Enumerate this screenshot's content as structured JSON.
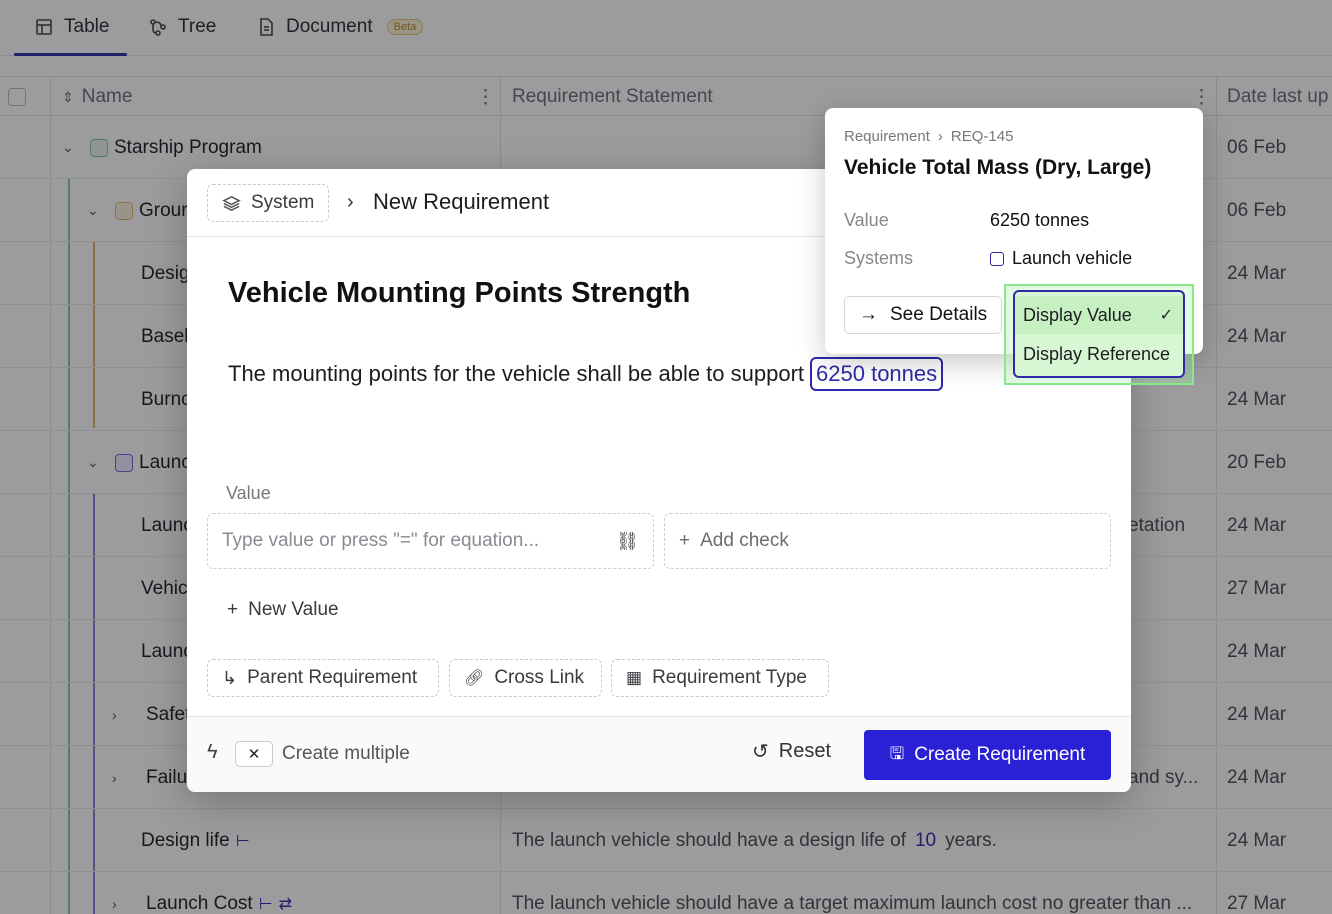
{
  "tabs": [
    {
      "label": "Table",
      "icon": "table-icon",
      "active": true
    },
    {
      "label": "Tree",
      "icon": "tree-icon",
      "active": false
    },
    {
      "label": "Document",
      "icon": "document-icon",
      "active": false,
      "badge": "Beta"
    }
  ],
  "grid": {
    "columns": {
      "name": "Name",
      "statement": "Requirement Statement",
      "date": "Date last up"
    },
    "rows": [
      {
        "name": "Starship Program",
        "date": "06 Feb"
      },
      {
        "name": "Grour",
        "date": "06 Feb"
      },
      {
        "name": "Desig",
        "date": "24 Mar"
      },
      {
        "name": "Basel",
        "date": "24 Mar"
      },
      {
        "name": "Burnc",
        "date": "24 Mar"
      },
      {
        "name": "Launc",
        "date": "20 Feb"
      },
      {
        "name": "Launc",
        "date": "24 Mar",
        "statement_tail": "etation"
      },
      {
        "name": "Vehic",
        "date": "27 Mar"
      },
      {
        "name": "Launc",
        "date": "24 Mar"
      },
      {
        "name": "Safet",
        "date": "24 Mar"
      },
      {
        "name": "Failur",
        "date": "24 Mar",
        "statement_tail": "and sy..."
      },
      {
        "name": "Design life",
        "date": "24 Mar",
        "statement_pre": "The launch vehicle should have a design life of",
        "statement_value": "10",
        "statement_post": "years."
      },
      {
        "name": "Launch Cost",
        "date": "27 Mar",
        "statement": "The launch vehicle should have a target maximum launch cost no greater than ..."
      }
    ]
  },
  "modal": {
    "system_label": "System",
    "title": "New Requirement",
    "requirement_title": "Vehicle Mounting Points Strength",
    "statement_text": "The mounting points for the vehicle shall be able to support",
    "statement_ref": "6250 tonnes",
    "value_label": "Value",
    "value_placeholder": "Type value or press \"=\" for equation...",
    "add_check": "Add check",
    "new_value": "New Value",
    "chips": [
      "Parent Requirement",
      "Cross Link",
      "Requirement Type"
    ],
    "create_multiple": "Create multiple",
    "kbd": "✕",
    "reset": "Reset",
    "create": "Create Requirement"
  },
  "card": {
    "crumb_root": "Requirement",
    "crumb_id": "REQ-145",
    "title": "Vehicle Total Mass (Dry, Large)",
    "value_key": "Value",
    "value": "6250 tonnes",
    "systems_key": "Systems",
    "system": "Launch vehicle",
    "see_details": "See Details"
  },
  "menu": {
    "items": [
      "Display Value",
      "Display Reference"
    ],
    "selected": "Display Value"
  },
  "colors": {
    "accent": "#2a20d6",
    "ref_blue": "#2f2aa8",
    "menu_green": "#d7f6d4"
  }
}
